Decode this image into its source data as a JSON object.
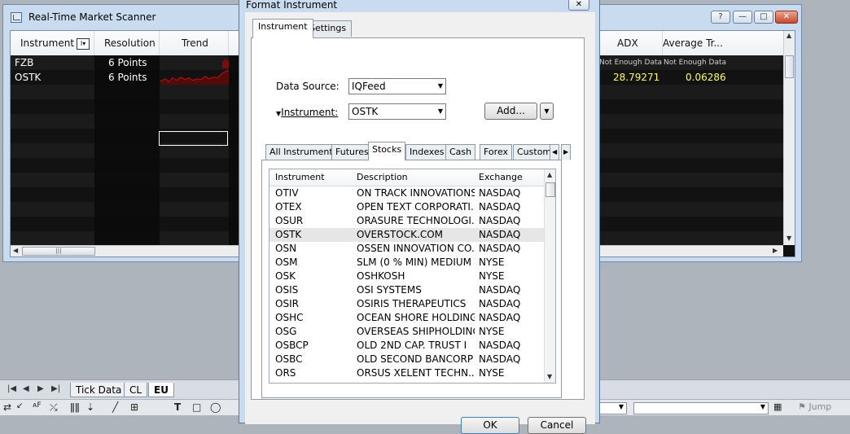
{
  "scanner": {
    "title": "Real-Time Market Scanner",
    "columns": {
      "instrument": "Instrument",
      "filter_glyph": "I▾",
      "resolution": "Resolution",
      "trend": "Trend",
      "adx": "ADX",
      "avg_true_range": "Average Tr..."
    },
    "rows": [
      {
        "instrument": "FZB",
        "resolution": "6 Points",
        "adx": "Not Enough Data",
        "atr": "Not Enough Data"
      },
      {
        "instrument": "OSTK",
        "resolution": "6 Points",
        "adx": "28.79271",
        "atr": "0.06286"
      }
    ],
    "window_buttons": {
      "help": "?",
      "minimize": "—",
      "maximize": "□",
      "close": "✕"
    }
  },
  "sheet_tabs": [
    "Tick Data",
    "CL",
    "EU"
  ],
  "active_sheet_tab": "EU",
  "bottom_toolbar": {
    "jump_label": "Jump"
  },
  "dialog": {
    "title": "Format Instrument",
    "close_glyph": "✕",
    "tabs": [
      "Instrument",
      "Settings"
    ],
    "active_tab": "Instrument",
    "data_source_label": "Data Source:",
    "data_source_value": "IQFeed",
    "instrument_label": "Instrument:",
    "instrument_value": "OSTK",
    "add_button": "Add...",
    "ok_button": "OK",
    "cancel_button": "Cancel",
    "sub_tabs": [
      "All Instruments",
      "Futures",
      "Stocks",
      "Indexes",
      "Cash",
      "Forex",
      "Custom"
    ],
    "active_sub_tab": "Stocks",
    "list_headers": {
      "instrument": "Instrument",
      "description": "Description",
      "exchange": "Exchange"
    },
    "list_rows": [
      {
        "instrument": "OTIV",
        "description": "ON TRACK INNOVATIONS",
        "exchange": "NASDAQ"
      },
      {
        "instrument": "OTEX",
        "description": "OPEN TEXT CORPORATI...",
        "exchange": "NASDAQ"
      },
      {
        "instrument": "OSUR",
        "description": "ORASURE TECHNOLOGI...",
        "exchange": "NASDAQ"
      },
      {
        "instrument": "OSTK",
        "description": "OVERSTOCK.COM",
        "exchange": "NASDAQ"
      },
      {
        "instrument": "OSN",
        "description": "OSSEN INNOVATION CO.",
        "exchange": "NASDAQ"
      },
      {
        "instrument": "OSM",
        "description": "SLM (0 % MIN) MEDIUM T...",
        "exchange": "NYSE"
      },
      {
        "instrument": "OSK",
        "description": "OSHKOSH",
        "exchange": "NYSE"
      },
      {
        "instrument": "OSIS",
        "description": "OSI SYSTEMS",
        "exchange": "NASDAQ"
      },
      {
        "instrument": "OSIR",
        "description": "OSIRIS THERAPEUTICS",
        "exchange": "NASDAQ"
      },
      {
        "instrument": "OSHC",
        "description": "OCEAN SHORE HOLDING",
        "exchange": "NASDAQ"
      },
      {
        "instrument": "OSG",
        "description": "OVERSEAS SHIPHOLDING",
        "exchange": "NYSE"
      },
      {
        "instrument": "OSBCP",
        "description": "OLD 2ND CAP. TRUST I",
        "exchange": "NASDAQ"
      },
      {
        "instrument": "OSBC",
        "description": "OLD SECOND BANCORP",
        "exchange": "NASDAQ"
      },
      {
        "instrument": "ORS",
        "description": "ORSUS XELENT TECHN...",
        "exchange": "NYSE"
      }
    ],
    "selected_row": "OSTK"
  },
  "colors": {
    "trend_line": "#c81818",
    "value_yellow": "#ffff50",
    "grid_bg": "#101010"
  }
}
